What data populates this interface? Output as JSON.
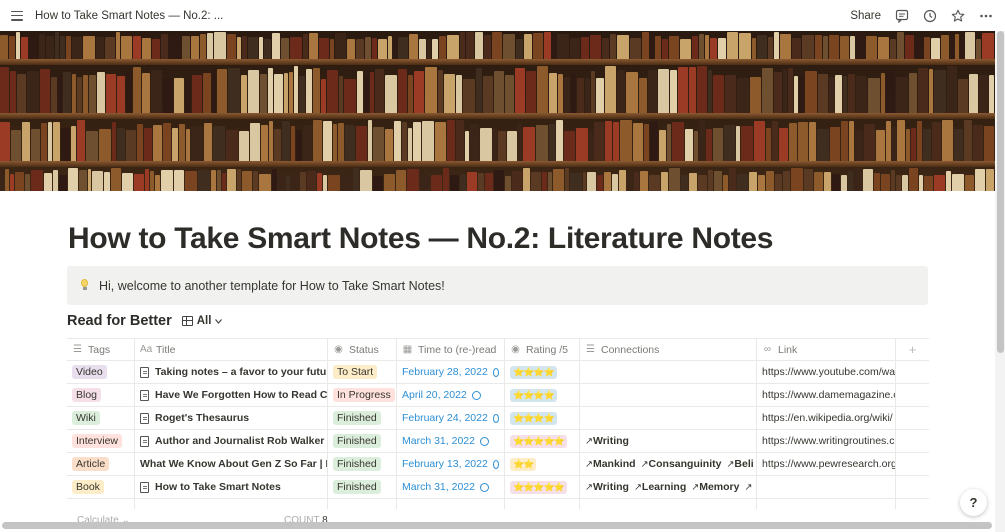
{
  "topbar": {
    "breadcrumb": "How to Take Smart Notes — No.2: ...",
    "share_label": "Share"
  },
  "page": {
    "title": "How to Take Smart Notes — No.2: Literature Notes",
    "callout": "Hi, welcome to another template for How to Take Smart Notes!"
  },
  "database": {
    "title": "Read for Better",
    "view_label": "All",
    "columns": [
      "Tags",
      "Title",
      "Status",
      "Time to (re-)read",
      "Rating /5",
      "Connections",
      "Link"
    ],
    "rows": [
      {
        "tag": "Video",
        "tag_color": "#e8deee",
        "title": "Taking notes – a favor to your future",
        "has_page_icon": true,
        "status": "To Start",
        "status_color": "#fdecc8",
        "date": "February 28, 2022",
        "rating": "⭐⭐⭐⭐",
        "rating_color": "#d3e5ef",
        "connections": [],
        "link": "https://www.youtube.com/wa"
      },
      {
        "tag": "Blog",
        "tag_color": "#f5e0e9",
        "title": "Have We Forgotten How to Read Cri",
        "has_page_icon": true,
        "status": "In Progress",
        "status_color": "#ffe2dd",
        "date": "April 20, 2022",
        "rating": "⭐⭐⭐⭐",
        "rating_color": "#d3e5ef",
        "connections": [],
        "link": "https://www.damemagazine.c"
      },
      {
        "tag": "Wiki",
        "tag_color": "#dbeddb",
        "title": "Roget's Thesaurus",
        "has_page_icon": true,
        "status": "Finished",
        "status_color": "#dbeddb",
        "date": "February 24, 2022",
        "rating": "⭐⭐⭐⭐",
        "rating_color": "#d3e5ef",
        "connections": [],
        "link": "https://en.wikipedia.org/wiki/"
      },
      {
        "tag": "Interview",
        "tag_color": "#ffe2dd",
        "title": "Author and Journalist Rob Walker or",
        "has_page_icon": true,
        "status": "Finished",
        "status_color": "#dbeddb",
        "date": "March 31, 2022",
        "rating": "⭐⭐⭐⭐⭐",
        "rating_color": "#f5e0e9",
        "connections": [
          "Writing"
        ],
        "link": "https://www.writingroutines.c"
      },
      {
        "tag": "Article",
        "tag_color": "#fadec9",
        "title": "What We Know About Gen Z So Far | Pe",
        "has_page_icon": false,
        "status": "Finished",
        "status_color": "#dbeddb",
        "date": "February 13, 2022",
        "rating": "⭐⭐",
        "rating_color": "#fdecc8",
        "connections": [
          "Mankind",
          "Consanguinity",
          "Beli"
        ],
        "link": "https://www.pewresearch.org"
      },
      {
        "tag": "Book",
        "tag_color": "#fdecc8",
        "title": "How to Take Smart Notes",
        "has_page_icon": true,
        "status": "Finished",
        "status_color": "#dbeddb",
        "date": "March 31, 2022",
        "rating": "⭐⭐⭐⭐⭐",
        "rating_color": "#f5e0e9",
        "connections": [
          "Writing",
          "Learning",
          "Memory",
          ""
        ],
        "link": ""
      }
    ],
    "calculate_label": "Calculate",
    "count_label": "COUNT",
    "count_value": "8"
  },
  "help_label": "?"
}
